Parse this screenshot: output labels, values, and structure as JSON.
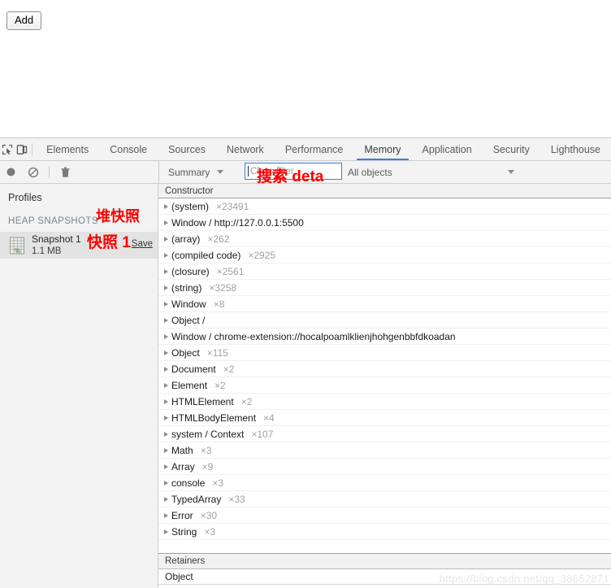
{
  "page": {
    "add_button_label": "Add"
  },
  "devtools": {
    "icons": {
      "inspect": "inspect-element-icon",
      "device": "device-toolbar-icon",
      "record": "record-circle-icon",
      "clear": "clear-no-entry-icon",
      "trash": "trash-can-icon"
    },
    "tabs": [
      {
        "label": "Elements",
        "active": false
      },
      {
        "label": "Console",
        "active": false
      },
      {
        "label": "Sources",
        "active": false
      },
      {
        "label": "Network",
        "active": false
      },
      {
        "label": "Performance",
        "active": false
      },
      {
        "label": "Memory",
        "active": true
      },
      {
        "label": "Application",
        "active": false
      },
      {
        "label": "Security",
        "active": false
      },
      {
        "label": "Lighthouse",
        "active": false
      }
    ],
    "accent_color": "#3b7ddd",
    "toolbar": {
      "view_select": "Summary",
      "class_filter_placeholder": "Class filter",
      "class_filter_value": "",
      "objects_select": "All objects"
    },
    "sidebar": {
      "title": "Profiles",
      "group_label": "HEAP SNAPSHOTS",
      "snapshot": {
        "name": "Snapshot 1",
        "size": "1.1 MB",
        "save_label": "Save",
        "icon": "heap-snapshot-icon"
      }
    },
    "grid": {
      "column_header": "Constructor",
      "rows": [
        {
          "name": "(system)",
          "count": "×23491"
        },
        {
          "name": "Window / http://127.0.0.1:5500",
          "count": ""
        },
        {
          "name": "(array)",
          "count": "×262"
        },
        {
          "name": "(compiled code)",
          "count": "×2925"
        },
        {
          "name": "(closure)",
          "count": "×2561"
        },
        {
          "name": "(string)",
          "count": "×3258"
        },
        {
          "name": "Window",
          "count": "×8"
        },
        {
          "name": "Object /",
          "count": ""
        },
        {
          "name": "Window / chrome-extension://hocalpoamlklienjhohgenbbfdkoadan",
          "count": ""
        },
        {
          "name": "Object",
          "count": "×115"
        },
        {
          "name": "Document",
          "count": "×2"
        },
        {
          "name": "Element",
          "count": "×2"
        },
        {
          "name": "HTMLElement",
          "count": "×2"
        },
        {
          "name": "HTMLBodyElement",
          "count": "×4"
        },
        {
          "name": "system / Context",
          "count": "×107"
        },
        {
          "name": "Math",
          "count": "×3"
        },
        {
          "name": "Array",
          "count": "×9"
        },
        {
          "name": "console",
          "count": "×3"
        },
        {
          "name": "TypedArray",
          "count": "×33"
        },
        {
          "name": "Error",
          "count": "×30"
        },
        {
          "name": "String",
          "count": "×3"
        }
      ]
    },
    "retainers": {
      "column_header": "Retainers",
      "rows": [
        {
          "name": "Object"
        }
      ]
    }
  },
  "annotations": {
    "color": "#ff0000",
    "heap_snapshot": "堆快照",
    "snapshot_one": "快照 1",
    "search": "搜索 deta"
  },
  "watermark": "https://blog.csdn.net/qq_38652871"
}
